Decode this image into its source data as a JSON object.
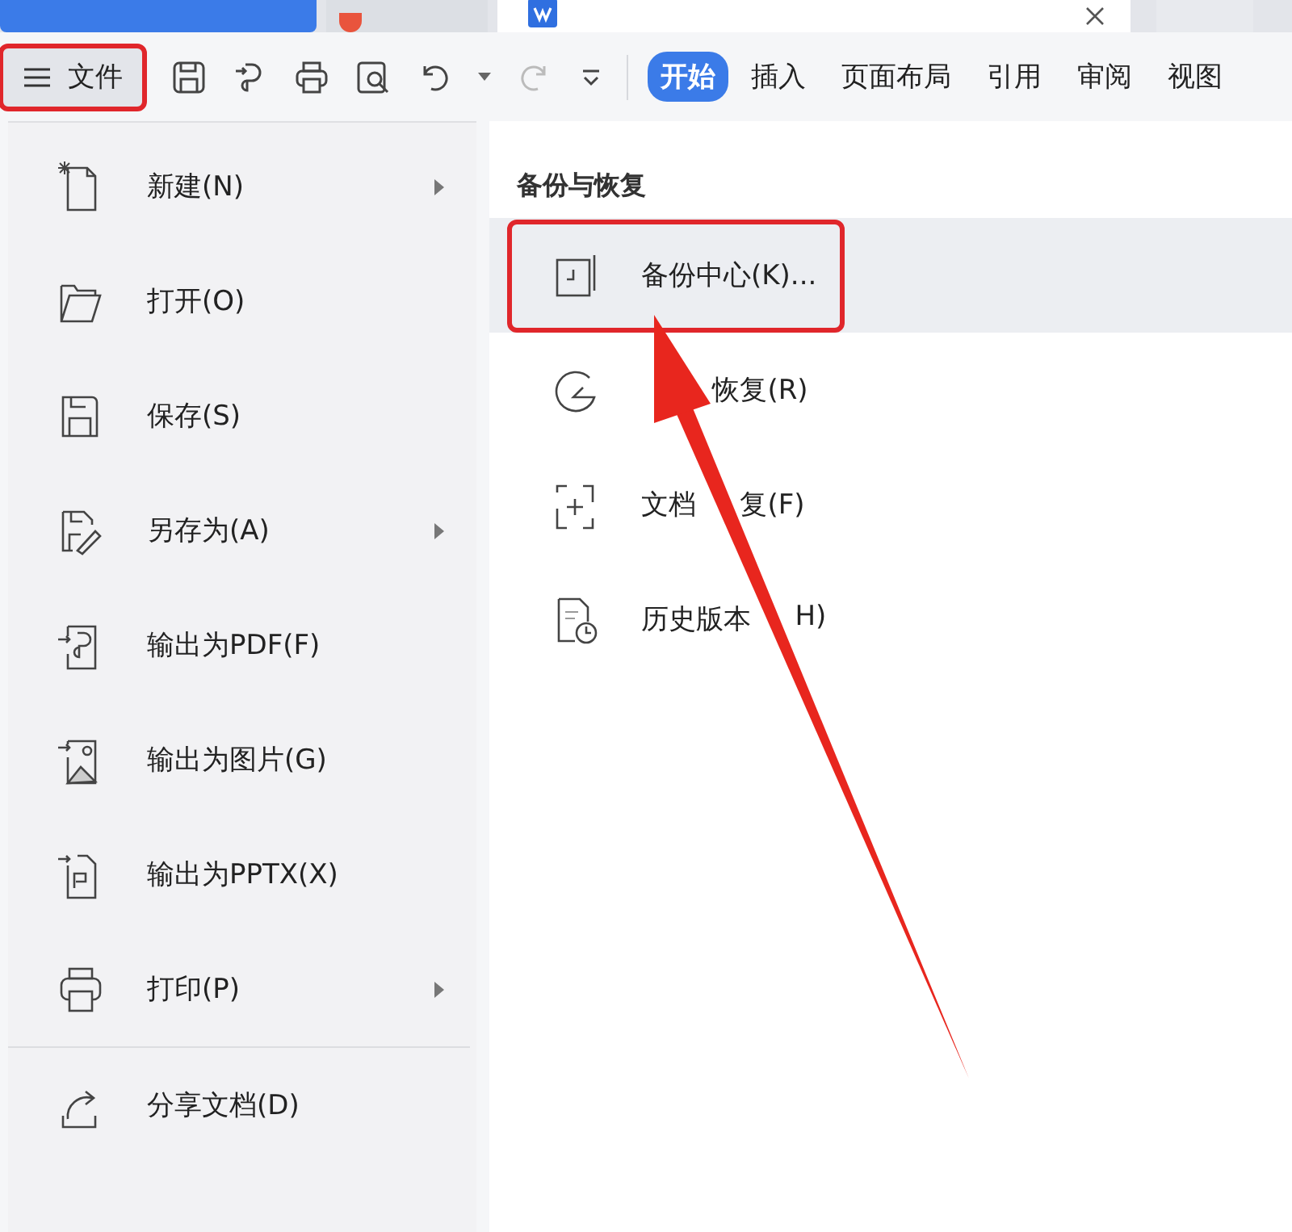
{
  "file_button": {
    "label": "文件",
    "annotated": true
  },
  "ribbon_tabs": [
    {
      "label": "开始",
      "selected": true
    },
    {
      "label": "插入",
      "selected": false
    },
    {
      "label": "页面布局",
      "selected": false
    },
    {
      "label": "引用",
      "selected": false
    },
    {
      "label": "审阅",
      "selected": false
    },
    {
      "label": "视图",
      "selected": false
    }
  ],
  "file_menu": {
    "groups": [
      [
        {
          "label": "新建(N)",
          "submenu": true
        },
        {
          "label": "打开(O)",
          "submenu": false
        },
        {
          "label": "保存(S)",
          "submenu": false
        },
        {
          "label": "另存为(A)",
          "submenu": true
        },
        {
          "label": "输出为PDF(F)",
          "submenu": false
        },
        {
          "label": "输出为图片(G)",
          "submenu": false
        },
        {
          "label": "输出为PPTX(X)",
          "submenu": false
        },
        {
          "label": "打印(P)",
          "submenu": true
        }
      ],
      [
        {
          "label": "分享文档(D)",
          "submenu": false
        }
      ]
    ]
  },
  "backup_panel": {
    "heading": "备份与恢复",
    "items": [
      {
        "label_parts": [
          "备份中心(K)..."
        ],
        "covered_start": false,
        "selected": true,
        "annotated": true
      },
      {
        "label_parts": [
          "恢复(R)"
        ],
        "covered_start": true,
        "selected": false,
        "annotated": false
      },
      {
        "label_parts": [
          "文档",
          "复(F)"
        ],
        "covered_start": false,
        "selected": false,
        "annotated": false
      },
      {
        "label_parts": [
          "历史版本",
          "H)"
        ],
        "covered_start": false,
        "selected": false,
        "annotated": false
      }
    ]
  }
}
